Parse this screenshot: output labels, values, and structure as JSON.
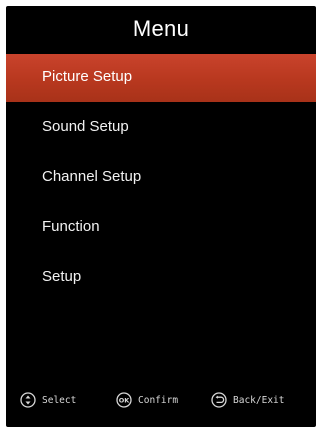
{
  "menu": {
    "title": "Menu",
    "items": [
      {
        "label": "Picture Setup",
        "selected": true
      },
      {
        "label": "Sound Setup",
        "selected": false
      },
      {
        "label": "Channel Setup",
        "selected": false
      },
      {
        "label": "Function",
        "selected": false
      },
      {
        "label": "Setup",
        "selected": false
      }
    ]
  },
  "footer": {
    "select_label": "Select",
    "confirm_label": "Confirm",
    "back_label": "Back/Exit",
    "select_icon": "up-down-circle-icon",
    "confirm_icon": "ok-circle-icon",
    "back_icon": "return-arrow-icon",
    "ok_glyph": "OK"
  },
  "colors": {
    "highlight": "#b8381f",
    "background": "#000000",
    "text": "#ffffff"
  }
}
